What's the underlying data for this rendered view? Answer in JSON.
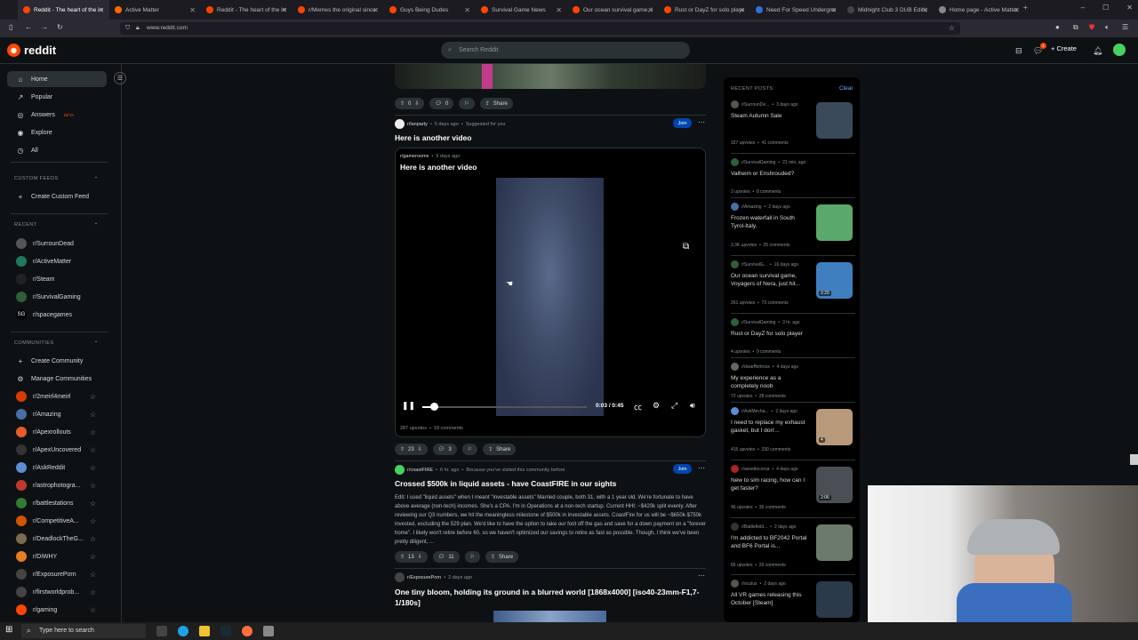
{
  "browser": {
    "tabs": [
      {
        "title": "Reddit - The heart of the internet",
        "color": "#ff4500",
        "active": true
      },
      {
        "title": "Active Matter",
        "color": "#ff6a00",
        "active": false
      },
      {
        "title": "Reddit - The heart of the internet",
        "color": "#ff4500",
        "active": false
      },
      {
        "title": "r/Memes the original since 2008",
        "color": "#ff4500",
        "active": false
      },
      {
        "title": "Guys Being Dudes",
        "color": "#ff4500",
        "active": false
      },
      {
        "title": "Survival Game News",
        "color": "#ff4500",
        "active": false
      },
      {
        "title": "Our ocean survival game, Voyagers",
        "color": "#ff4500",
        "active": false
      },
      {
        "title": "Rust or DayZ for solo player",
        "color": "#ff4500",
        "active": false
      },
      {
        "title": "Need For Speed Underground",
        "color": "#2f6fd6",
        "active": false
      },
      {
        "title": "Midnight Club 3 DUB Edition",
        "color": "#444",
        "active": false
      },
      {
        "title": "Home page - Active Matter",
        "color": "#888",
        "active": false
      }
    ],
    "url": "www.reddit.com"
  },
  "header": {
    "logo_text": "reddit",
    "search_placeholder": "Search Reddit",
    "create_label": "Create",
    "notification_count": "1"
  },
  "sidebar": {
    "nav": [
      {
        "label": "Home",
        "icon": "home-icon",
        "glyph": "⌂"
      },
      {
        "label": "Popular",
        "icon": "popular-icon",
        "glyph": "↗"
      },
      {
        "label": "Answers",
        "icon": "answers-icon",
        "glyph": "◎",
        "badge": "BETA"
      },
      {
        "label": "Explore",
        "icon": "explore-icon",
        "glyph": "◉"
      },
      {
        "label": "All",
        "icon": "all-icon",
        "glyph": "◷"
      }
    ],
    "custom_feeds_heading": "CUSTOM FEEDS",
    "create_custom_feed": "Create Custom Feed",
    "recent_heading": "RECENT",
    "recent": [
      {
        "label": "r/SurrounDead",
        "color": "#555"
      },
      {
        "label": "r/ActiveMatter",
        "color": "#1f7a5c"
      },
      {
        "label": "r/Steam",
        "color": "#222"
      },
      {
        "label": "r/SurvivalGaming",
        "color": "#2f5d3a"
      },
      {
        "label": "r/spacegames",
        "color": "#000",
        "abbr": "SG"
      }
    ],
    "communities_heading": "COMMUNITIES",
    "create_community": "Create Community",
    "manage_communities": "Manage Communities",
    "communities": [
      {
        "label": "r/2meirl4meirl",
        "color": "#d93a00"
      },
      {
        "label": "r/Amazing",
        "color": "#4a6fa5"
      },
      {
        "label": "r/Apexrollouts",
        "color": "#e85d2a"
      },
      {
        "label": "r/ApexUncovered",
        "color": "#333"
      },
      {
        "label": "r/AskReddit",
        "color": "#5b8ed6"
      },
      {
        "label": "r/astrophotogra...",
        "color": "#c0392b"
      },
      {
        "label": "r/battlestations",
        "color": "#2e7d32"
      },
      {
        "label": "r/CompetitiveA...",
        "color": "#d35400"
      },
      {
        "label": "r/DeadlockTheG...",
        "color": "#7a6a4f"
      },
      {
        "label": "r/DiWHY",
        "color": "#e67e22"
      },
      {
        "label": "r/ExposurePorn",
        "color": "#444"
      },
      {
        "label": "r/firstworldprob...",
        "color": "#444"
      },
      {
        "label": "r/gaming",
        "color": "#ff4500"
      }
    ]
  },
  "feed": {
    "top_post": {
      "votes": "0",
      "comments": "0",
      "share": "Share"
    },
    "post1": {
      "subreddit": "r/lanparty",
      "time": "5 days ago",
      "suggested": "Suggested for you",
      "join": "Join",
      "title": "Here is another video",
      "crosspost_sub": "r/gamerooms",
      "crosspost_time": "5 days ago",
      "crosspost_title": "Here is another video",
      "video_time": "0:03 / 0:45",
      "video_progress": 0.07,
      "cross_upvotes": "287 upvotes",
      "cross_comments": "18 comments",
      "votes": "23",
      "comments": "3",
      "share": "Share"
    },
    "post2": {
      "subreddit": "r/coastFIRE",
      "time": "6 hr. ago",
      "reason": "Because you've visited this community before",
      "join": "Join",
      "title": "Crossed $500k in liquid assets - have CoastFIRE in our sights",
      "body": "Edit: I used \"liquid assets\" when I meant \"investable assets\" Married couple, both 31, with a 1 year old. We're fortunate to have above average (non-tech) incomes. She's a CPA. I'm in Operations at a non-tech startup. Current HHI: ~$420k split evenly. After reviewing our Q3 numbers, we hit the meaningless milestone of $500k in investable assets. CoastFire for us will be ~$650k-$750k invested, excluding the 529 plan. We'd like to have the option to take our foot off the gas and save for a down payment on a \"forever home\". I likely won't retire before 60, so we haven't optimized our savings to retire as fast as possible. Though, I think we've been pretty diligent, ...",
      "votes": "13",
      "comments": "11",
      "share": "Share"
    },
    "post3": {
      "subreddit": "r/ExposurePorn",
      "time": "2 days ago",
      "title": "One tiny bloom, holding its ground in a blurred world [1868x4000] [iso40-23mm-F1,7-1/180s]"
    }
  },
  "recent_posts": {
    "heading": "RECENT POSTS",
    "clear": "Clear",
    "items": [
      {
        "sub": "r/SurrounDe...",
        "time": "3 days ago",
        "title": "Steam Autumn Sale",
        "upvotes": "327 upvotes",
        "comments": "41 comments",
        "thumb": "#3a4a5a",
        "subcolor": "#555"
      },
      {
        "sub": "r/SurvivalGaming",
        "time": "21 min. ago",
        "title": "Valheim or Enshrouded?",
        "upvotes": "2 upvotes",
        "comments": "8 comments",
        "thumb": "",
        "subcolor": "#2f5d3a"
      },
      {
        "sub": "r/Amazing",
        "time": "2 days ago",
        "title": "Frozen waterfall in South Tyrol-Italy.",
        "upvotes": "3.3K upvotes",
        "comments": "25 comments",
        "thumb": "#5aa86a",
        "subcolor": "#4a6fa5"
      },
      {
        "sub": "r/SurvivalG...",
        "time": "16 days ago",
        "title": "Our ocean survival game, Voyagers of Nera, just hit...",
        "upvotes": "261 upvotes",
        "comments": "73 comments",
        "thumb": "#3f7fbf",
        "subcolor": "#2f5d3a",
        "badge": "2:20"
      },
      {
        "sub": "r/SurvivalGaming",
        "time": "3 hr. ago",
        "title": "Rust or DayZ for solo player",
        "upvotes": "4 upvotes",
        "comments": "9 comments",
        "thumb": "",
        "subcolor": "#2f5d3a"
      },
      {
        "sub": "r/dwarffortress",
        "time": "4 days ago",
        "title": "My experience as a completely noob",
        "upvotes": "72 upvotes",
        "comments": "28 comments",
        "thumb": "",
        "subcolor": "#666"
      },
      {
        "sub": "r/AskMecha...",
        "time": "2 days ago",
        "title": "I need to replace my exhaust gasket, but I don'...",
        "upvotes": "415 upvotes",
        "comments": "330 comments",
        "thumb": "#b89a7a",
        "subcolor": "#5b8ed6",
        "badge": "4"
      },
      {
        "sub": "r/assettocorsa",
        "time": "4 days ago",
        "title": "New to sim racing, how can I get faster?",
        "upvotes": "46 upvotes",
        "comments": "36 comments",
        "thumb": "#4a4f55",
        "subcolor": "#aa2222",
        "badge": "2:06"
      },
      {
        "sub": "r/Battlefield...",
        "time": "2 days ago",
        "title": "I'm addicted to BF2042 Portal and BF6 Portal is...",
        "upvotes": "85 upvotes",
        "comments": "29 comments",
        "thumb": "#6b7a6a",
        "subcolor": "#333"
      },
      {
        "sub": "r/oculus",
        "time": "2 days ago",
        "title": "All VR games releasing this October [Steam]",
        "upvotes": "",
        "comments": "",
        "thumb": "#2a3a4a",
        "subcolor": "#555"
      }
    ]
  },
  "taskbar": {
    "search_placeholder": "Type here to search"
  }
}
